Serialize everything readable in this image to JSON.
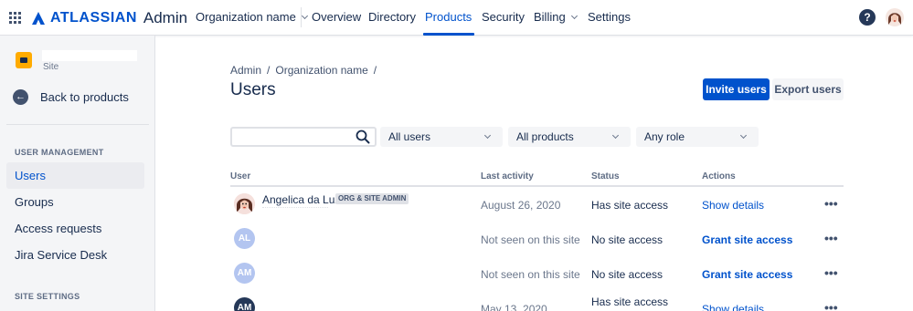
{
  "topnav": {
    "brand": "ATLASSIAN",
    "product": "Admin",
    "org_selector": "Organization name",
    "items": [
      "Overview",
      "Directory",
      "Products",
      "Security",
      "Billing",
      "Settings"
    ],
    "active": "Products",
    "help_glyph": "?"
  },
  "sidebar": {
    "site_label": "Site",
    "back_label": "Back to products",
    "user_management_heading": "USER MANAGEMENT",
    "items": [
      "Users",
      "Groups",
      "Access requests",
      "Jira Service Desk"
    ],
    "active_item": "Users",
    "site_settings_heading": "SITE SETTINGS"
  },
  "main": {
    "breadcrumb": [
      "Admin",
      "Organization name"
    ],
    "breadcrumb_separator": "/",
    "title": "Users",
    "invite_button": "Invite users",
    "export_button": "Export users"
  },
  "filters": {
    "search_value": "",
    "users_select": "All users",
    "products_select": "All products",
    "role_select": "Any role"
  },
  "table": {
    "headers": [
      "User",
      "Last activity",
      "Status",
      "Actions"
    ],
    "more_glyph": "•••",
    "rows": [
      {
        "avatar": "photo",
        "initials": "",
        "name": "Angelica da Luz",
        "badge": "ORG & SITE ADMIN",
        "last_activity": "August 26, 2020",
        "status": "Has site access",
        "action": "Show details"
      },
      {
        "avatar": "light",
        "initials": "AL",
        "name": "",
        "badge": "",
        "last_activity": "Not seen on this site",
        "status": "No site access",
        "action": "Grant site access"
      },
      {
        "avatar": "light",
        "initials": "AM",
        "name": "",
        "badge": "",
        "last_activity": "Not seen on this site",
        "status": "No site access",
        "action": "Grant site access"
      },
      {
        "avatar": "dark",
        "initials": "AM",
        "name": "",
        "badge": "",
        "last_activity": "May 13, 2020",
        "status": "Has site access",
        "action": "Show details"
      }
    ]
  },
  "colors": {
    "brand_blue": "#0052cc",
    "text": "#172b4d",
    "sidebar_bg": "#f4f5f7",
    "site_icon": "#ffab00"
  },
  "icons": [
    "app-switcher-icon",
    "atlassian-logo-icon",
    "help-icon",
    "profile-avatar",
    "site-icon",
    "back-arrow-icon",
    "search-icon",
    "chevron-down-icon",
    "more-icon"
  ]
}
